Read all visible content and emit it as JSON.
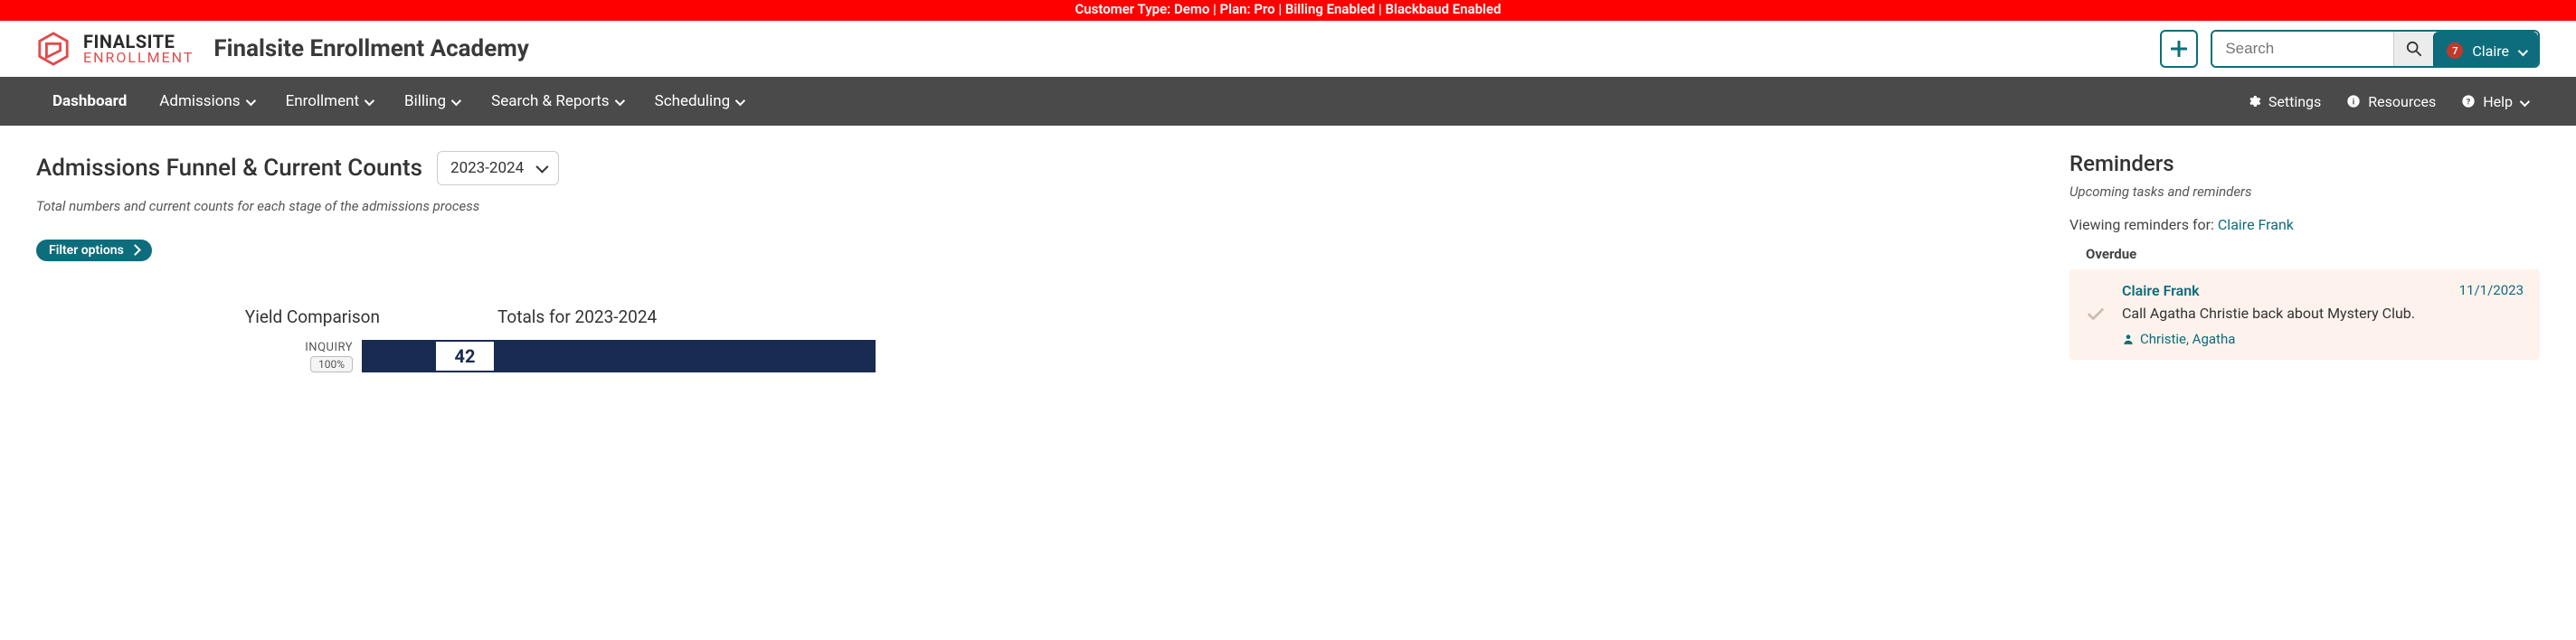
{
  "banner": "Customer Type: Demo | Plan: Pro | Billing Enabled | Blackbaud Enabled",
  "brand": {
    "line1": "FINALSITE",
    "line2": "ENROLLMENT"
  },
  "site_title": "Finalsite Enrollment Academy",
  "search": {
    "placeholder": "Search"
  },
  "user": {
    "name": "Claire",
    "notif_count": "7"
  },
  "nav": {
    "items": [
      {
        "label": "Dashboard"
      },
      {
        "label": "Admissions"
      },
      {
        "label": "Enrollment"
      },
      {
        "label": "Billing"
      },
      {
        "label": "Search & Reports"
      },
      {
        "label": "Scheduling"
      }
    ],
    "right": [
      {
        "label": "Settings"
      },
      {
        "label": "Resources"
      },
      {
        "label": "Help"
      }
    ]
  },
  "funnel": {
    "title": "Admissions Funnel & Current Counts",
    "year": "2023-2024",
    "subtitle": "Total numbers and current counts for each stage of the admissions process",
    "filter_label": "Filter options",
    "headers": {
      "yield": "Yield Comparison",
      "totals": "Totals for 2023-2024"
    },
    "rows": [
      {
        "stage": "INQUIRY",
        "pct": "100%",
        "total": "42"
      }
    ]
  },
  "reminders": {
    "title": "Reminders",
    "subtitle": "Upcoming tasks and reminders",
    "viewing_prefix": "Viewing reminders for: ",
    "viewing_user": "Claire Frank",
    "overdue_label": "Overdue",
    "items": [
      {
        "owner": "Claire Frank",
        "date": "11/1/2023",
        "text": "Call Agatha Christie back about Mystery Club.",
        "person": "Christie, Agatha"
      }
    ]
  },
  "chart_data": {
    "type": "bar",
    "title": "Admissions Funnel & Current Counts",
    "series": [
      {
        "name": "Yield Comparison",
        "categories": [
          "INQUIRY"
        ],
        "values_pct": [
          100
        ]
      },
      {
        "name": "Totals for 2023-2024",
        "categories": [
          "INQUIRY"
        ],
        "values": [
          42
        ]
      }
    ]
  }
}
